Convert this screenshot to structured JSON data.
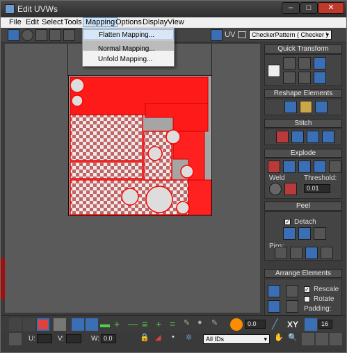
{
  "window": {
    "title": "Edit UVWs",
    "min": "–",
    "max": "□",
    "close": "✕"
  },
  "menu": {
    "items": [
      "File",
      "Edit",
      "Select",
      "Tools",
      "Mapping",
      "Options",
      "Display",
      "View"
    ],
    "active": "Mapping"
  },
  "mapping_menu": {
    "items": [
      "Flatten Mapping...",
      "Normal Mapping...",
      "Unfold Mapping..."
    ]
  },
  "toolbar": {
    "uv_label": "UV",
    "texture_select": "CheckerPattern  ( Checker )"
  },
  "panel": {
    "quick_transform": "Quick Transform",
    "reshape": "Reshape Elements",
    "stitch": "Stitch",
    "explode": "Explode",
    "weld": "Weld",
    "threshold_label": "Threshold:",
    "threshold_value": "0.01",
    "peel": "Peel",
    "detach": "Detach",
    "pins": "Pins:",
    "arrange": "Arrange Elements",
    "rescale": "Rescale",
    "rotate": "Rotate",
    "padding": "Padding:"
  },
  "bottom": {
    "spinner1": "0.0",
    "xy": "XY",
    "zoom_val": "16",
    "u_label": "U:",
    "v_label": "V:",
    "w_label": "W:",
    "w_val": "0.0",
    "ids": "All IDs"
  },
  "colors": {
    "accent": "#ff0000",
    "panel": "#444444",
    "menu_bg": "#f0f0f0"
  }
}
